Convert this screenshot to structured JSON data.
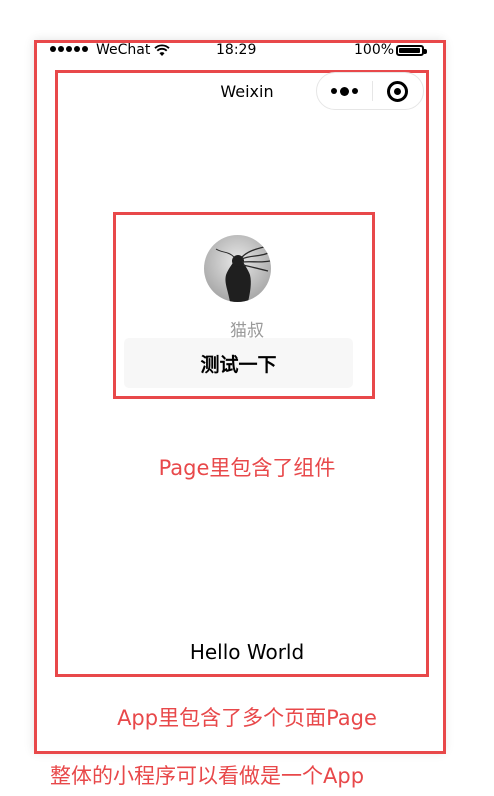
{
  "status_bar": {
    "carrier": "WeChat",
    "time": "18:29",
    "battery": "100%"
  },
  "nav": {
    "title": "Weixin"
  },
  "profile": {
    "name": "猫叔",
    "button_label": "测试一下"
  },
  "page_content": {
    "hello": "Hello World"
  },
  "annotations": {
    "page_label": "Page里包含了组件",
    "app_label": "App里包含了多个页面Page",
    "miniprogram_label": "整体的小程序可以看做是一个App"
  },
  "colors": {
    "annotation_red": "#e8484a",
    "button_bg": "#f7f7f7",
    "name_gray": "#9a9a9a"
  }
}
